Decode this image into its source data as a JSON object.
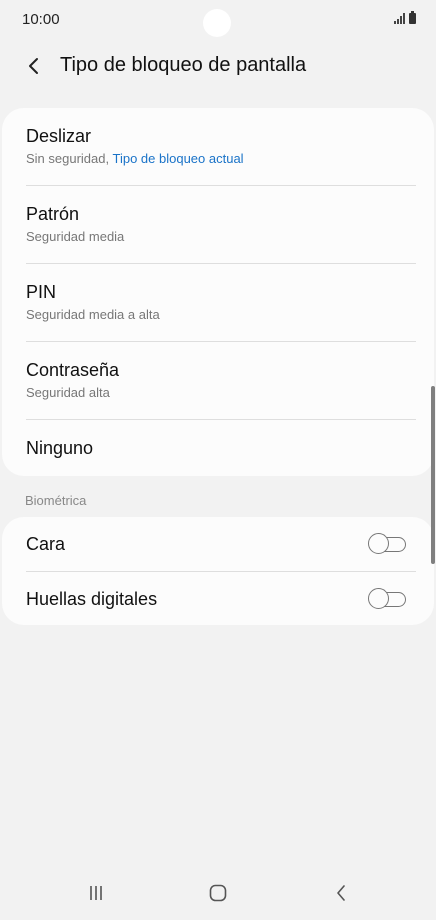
{
  "status_bar": {
    "time": "10:00"
  },
  "header": {
    "title": "Tipo de bloqueo de pantalla"
  },
  "lock_options": [
    {
      "title": "Deslizar",
      "subtitle": "Sin seguridad, ",
      "subtitle_accent": "Tipo de bloqueo actual"
    },
    {
      "title": "Patrón",
      "subtitle": "Seguridad media"
    },
    {
      "title": "PIN",
      "subtitle": "Seguridad media a alta"
    },
    {
      "title": "Contraseña",
      "subtitle": "Seguridad alta"
    },
    {
      "title": "Ninguno"
    }
  ],
  "biometrics": {
    "section_label": "Biométrica",
    "items": [
      {
        "title": "Cara",
        "enabled": false
      },
      {
        "title": "Huellas digitales",
        "enabled": false
      }
    ]
  },
  "colors": {
    "accent": "#1a73c8",
    "background": "#f2f2f2",
    "card": "#fcfcfc"
  },
  "nav_bar": {
    "icons": [
      "recents-icon",
      "home-icon",
      "back-icon"
    ]
  }
}
